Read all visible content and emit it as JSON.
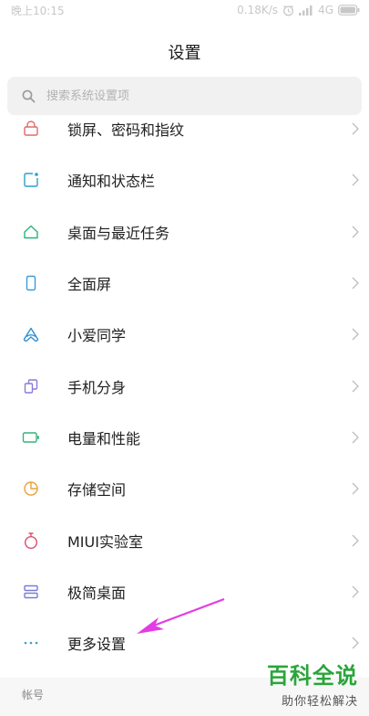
{
  "status_bar": {
    "time": "晚上10:15",
    "network_speed": "0.18K/s",
    "network_type": "4G",
    "icons": [
      "alarm-icon",
      "signal-icon",
      "battery-icon"
    ]
  },
  "header": {
    "title": "设置"
  },
  "search": {
    "placeholder": "搜索系统设置项",
    "value": ""
  },
  "settings_items": [
    {
      "label": "锁屏、密码和指纹",
      "icon": "lock-icon",
      "color": "#e26a6a"
    },
    {
      "label": "通知和状态栏",
      "icon": "notification-icon",
      "color": "#2aa0c8"
    },
    {
      "label": "桌面与最近任务",
      "icon": "home-icon",
      "color": "#2ab37d"
    },
    {
      "label": "全面屏",
      "icon": "phone-icon",
      "color": "#3a9cd8"
    },
    {
      "label": "小爱同学",
      "icon": "assistant-icon",
      "color": "#2d8fd6"
    },
    {
      "label": "手机分身",
      "icon": "dual-space-icon",
      "color": "#8f7ad6"
    },
    {
      "label": "电量和性能",
      "icon": "battery-performance-icon",
      "color": "#36b27a"
    },
    {
      "label": "存储空间",
      "icon": "storage-icon",
      "color": "#e8a23c"
    },
    {
      "label": "MIUI实验室",
      "icon": "lab-icon",
      "color": "#d94f6e"
    },
    {
      "label": "极简桌面",
      "icon": "simple-launcher-icon",
      "color": "#7a7ad9"
    },
    {
      "label": "更多设置",
      "icon": "more-icon",
      "color": "#3aa0c8"
    }
  ],
  "section": {
    "label": "帐号"
  },
  "watermark": {
    "title": "百科全说",
    "subtitle": "助你轻松解决"
  },
  "annotation": {
    "arrow_color": "#e33be6"
  }
}
